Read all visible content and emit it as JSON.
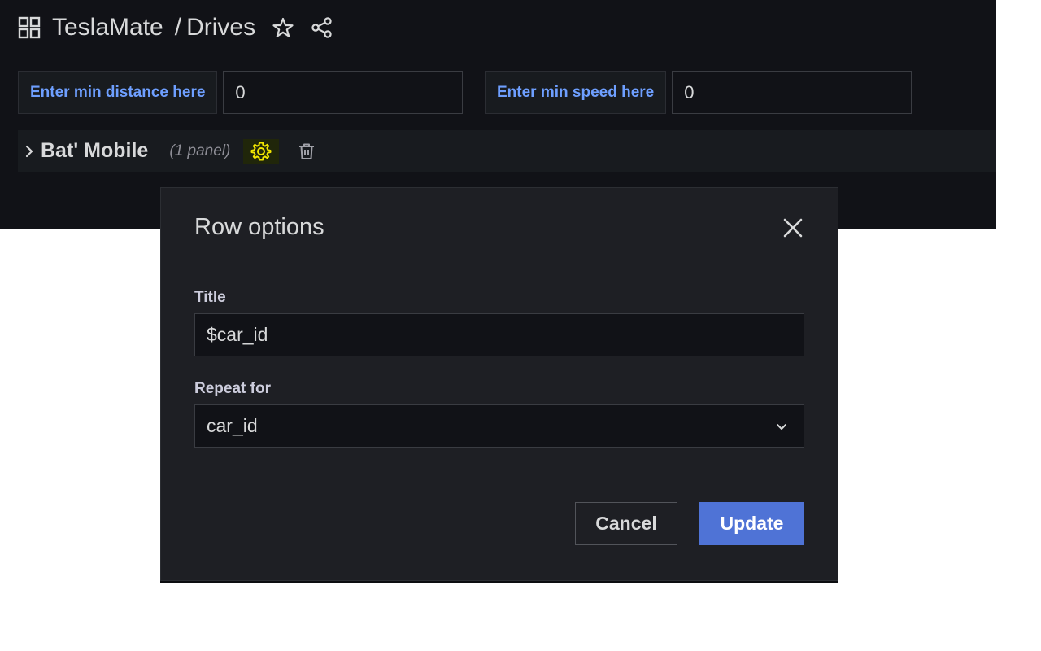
{
  "header": {
    "root_label": "TeslaMate",
    "separator": "/",
    "page_label": "Drives",
    "icons": [
      "grid-icon",
      "star-icon",
      "share-icon"
    ]
  },
  "variables": [
    {
      "label": "Enter min distance here",
      "value": "0"
    },
    {
      "label": "Enter min speed here",
      "value": "0"
    }
  ],
  "row": {
    "title": "Bat' Mobile",
    "panel_count": "(1 panel)",
    "icons": [
      "chevron-right-icon",
      "gear-icon",
      "trash-icon"
    ]
  },
  "modal": {
    "title": "Row options",
    "fields": {
      "title_label": "Title",
      "title_value": "$car_id",
      "repeat_label": "Repeat for",
      "repeat_value": "car_id"
    },
    "buttons": {
      "cancel": "Cancel",
      "update": "Update"
    }
  },
  "colors": {
    "background": "#111217",
    "accent_link": "#6e9fff",
    "primary_button": "#4f73d6",
    "gear_highlight": "#f2e600"
  }
}
